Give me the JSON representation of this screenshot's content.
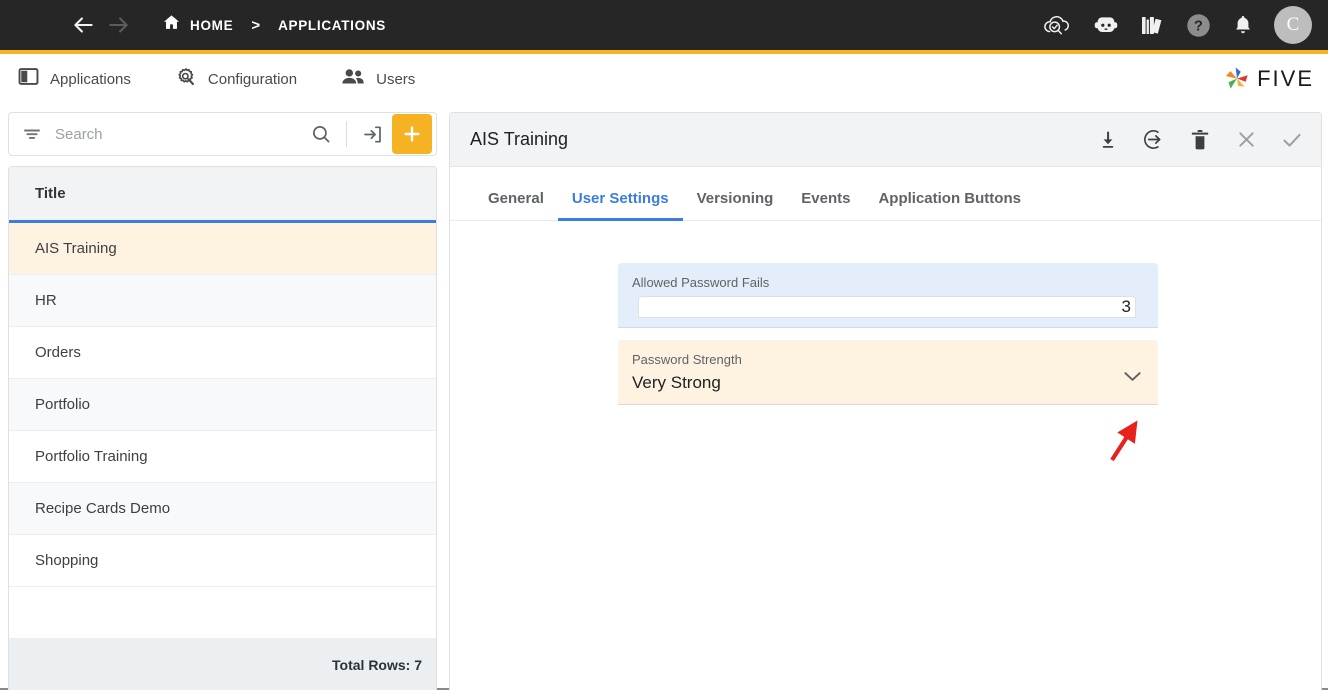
{
  "header": {
    "menu_icon": "hamburger-icon",
    "back_icon": "arrow-left-icon",
    "forward_icon": "arrow-right-icon",
    "home_icon": "home-icon",
    "breadcrumb": [
      {
        "label": "HOME"
      },
      {
        "label": "APPLICATIONS"
      }
    ],
    "separator": ">",
    "actions": [
      {
        "name": "cloud-check-icon"
      },
      {
        "name": "robot-icon"
      },
      {
        "name": "books-icon"
      },
      {
        "name": "help-icon"
      },
      {
        "name": "bell-icon"
      }
    ],
    "avatar_initial": "C",
    "accent_color": "#f5b324",
    "background_color": "#262626"
  },
  "module_tabs": [
    {
      "label": "Applications",
      "icon": "applications-icon"
    },
    {
      "label": "Configuration",
      "icon": "configuration-gear-icon"
    },
    {
      "label": "Users",
      "icon": "users-icon"
    }
  ],
  "brand": {
    "word": "FIVE",
    "logo_icon": "five-pinwheel-logo"
  },
  "left_panel": {
    "search": {
      "placeholder": "Search",
      "value": ""
    },
    "filter_icon": "filter-icon",
    "search_icon": "search-icon",
    "import_icon": "import-arrow-icon",
    "add_label": "+",
    "add_color": "#f5b324",
    "column_header": "Title",
    "rows": [
      {
        "title": "AIS Training",
        "selected": true
      },
      {
        "title": "HR",
        "selected": false
      },
      {
        "title": "Orders",
        "selected": false
      },
      {
        "title": "Portfolio",
        "selected": false
      },
      {
        "title": "Portfolio Training",
        "selected": false
      },
      {
        "title": "Recipe Cards Demo",
        "selected": false
      },
      {
        "title": "Shopping",
        "selected": false
      }
    ],
    "footer": "Total Rows: 7"
  },
  "right_panel": {
    "title": "AIS Training",
    "actions": [
      {
        "name": "download-icon"
      },
      {
        "name": "export-arrow-circle-icon"
      },
      {
        "name": "delete-trash-icon"
      },
      {
        "name": "close-x-icon"
      },
      {
        "name": "confirm-check-icon"
      }
    ],
    "tabs": [
      {
        "label": "General",
        "active": false
      },
      {
        "label": "User Settings",
        "active": true
      },
      {
        "label": "Versioning",
        "active": false
      },
      {
        "label": "Events",
        "active": false
      },
      {
        "label": "Application Buttons",
        "active": false
      }
    ],
    "active_tab_color": "#3b7ddd",
    "fields": [
      {
        "label": "Allowed Password Fails",
        "value": "3",
        "style": "blue",
        "background": "#e3eefa",
        "align": "right",
        "has_chevron": false
      },
      {
        "label": "Password Strength",
        "value": "Very Strong",
        "style": "cream",
        "background": "#fdf3e0",
        "align": "left",
        "has_chevron": true,
        "chevron_icon": "chevron-down-icon"
      }
    ],
    "annotation": {
      "type": "arrow",
      "color": "#e8211c",
      "points_to": "chevron-down-icon"
    }
  }
}
